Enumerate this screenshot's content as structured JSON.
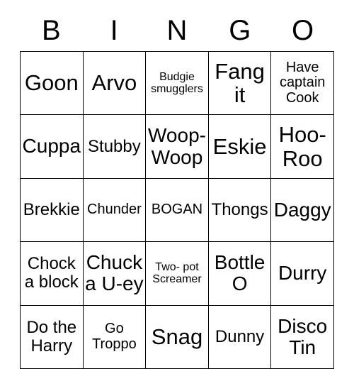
{
  "card": {
    "header_letters": [
      "B",
      "I",
      "N",
      "G",
      "O"
    ],
    "rows": [
      [
        {
          "text": "Goon",
          "size": "fs-xl"
        },
        {
          "text": "Arvo",
          "size": "fs-xl"
        },
        {
          "text": "Budgie smugglers",
          "size": "fs-xs"
        },
        {
          "text": "Fang it",
          "size": "fs-xl"
        },
        {
          "text": "Have captain Cook",
          "size": "fs-sm"
        }
      ],
      [
        {
          "text": "Cuppa",
          "size": "fs-lg"
        },
        {
          "text": "Stubby",
          "size": "fs-md"
        },
        {
          "text": "Woop-Woop",
          "size": "fs-lg"
        },
        {
          "text": "Eskie",
          "size": "fs-xl"
        },
        {
          "text": "Hoo-Roo",
          "size": "fs-xl"
        }
      ],
      [
        {
          "text": "Brekkie",
          "size": "fs-md"
        },
        {
          "text": "Chunder",
          "size": "fs-sm"
        },
        {
          "text": "BOGAN",
          "size": "fs-sm"
        },
        {
          "text": "Thongs",
          "size": "fs-md"
        },
        {
          "text": "Daggy",
          "size": "fs-lg"
        }
      ],
      [
        {
          "text": "Chock a block",
          "size": "fs-md"
        },
        {
          "text": "Chuck a U-ey",
          "size": "fs-lg"
        },
        {
          "text": "Two- pot Screamer",
          "size": "fs-xs"
        },
        {
          "text": "Bottle O",
          "size": "fs-lg"
        },
        {
          "text": "Durry",
          "size": "fs-lg"
        }
      ],
      [
        {
          "text": "Do the Harry",
          "size": "fs-md"
        },
        {
          "text": "Go Troppo",
          "size": "fs-sm"
        },
        {
          "text": "Snag",
          "size": "fs-xl"
        },
        {
          "text": "Dunny",
          "size": "fs-md"
        },
        {
          "text": "Disco Tin",
          "size": "fs-lg"
        }
      ]
    ]
  }
}
